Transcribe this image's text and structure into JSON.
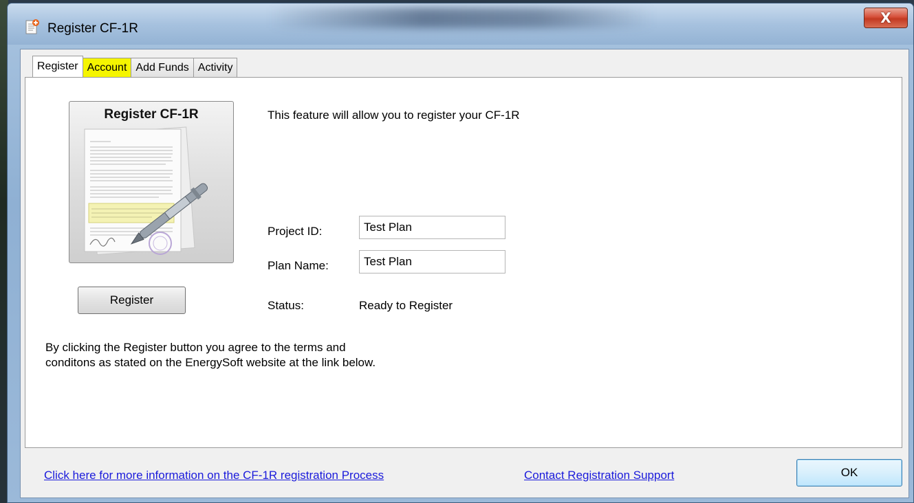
{
  "window": {
    "title": "Register CF-1R",
    "close_glyph": "X"
  },
  "tabs": [
    {
      "label": "Register",
      "active": true
    },
    {
      "label": "Account",
      "highlighted": true
    },
    {
      "label": "Add Funds"
    },
    {
      "label": "Activity"
    }
  ],
  "register_panel": {
    "image_title": "Register CF-1R",
    "description": "This feature will allow you to register your CF-1R",
    "project_id": {
      "label": "Project ID:",
      "value": "Test Plan"
    },
    "plan_name": {
      "label": "Plan Name:",
      "value": "Test Plan"
    },
    "status": {
      "label": "Status:",
      "value": "Ready to Register"
    },
    "register_button": "Register",
    "terms_text_line1": "By clicking the Register button you agree to the terms and",
    "terms_text_line2": "conditons as stated on the EnergySoft website at the link below."
  },
  "footer": {
    "info_link": "Click here for more information on the CF-1R registration Process",
    "support_link": "Contact Registration Support",
    "ok_button": "OK"
  },
  "colors": {
    "tab_highlight": "#f5f500",
    "link": "#1a1adb",
    "close_button": "#c23a22"
  },
  "icons": {
    "app": "register-document-icon",
    "close": "close-icon",
    "feature": "pen-signing-document-image"
  }
}
